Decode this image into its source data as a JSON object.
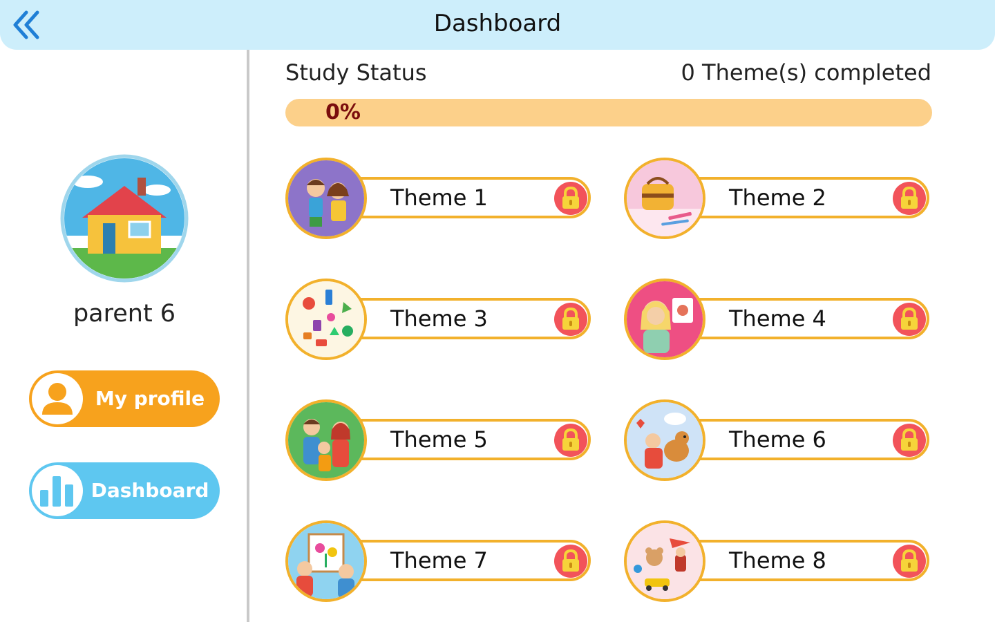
{
  "header": {
    "title": "Dashboard"
  },
  "sidebar": {
    "username": "parent 6",
    "profile_label": "My profile",
    "dashboard_label": "Dashboard"
  },
  "status": {
    "label": "Study Status",
    "completed_text": "0 Theme(s) completed",
    "progress_text": "0%",
    "progress_percent": 0
  },
  "themes": [
    {
      "label": "Theme 1",
      "locked": true
    },
    {
      "label": "Theme 2",
      "locked": true
    },
    {
      "label": "Theme 3",
      "locked": true
    },
    {
      "label": "Theme 4",
      "locked": true
    },
    {
      "label": "Theme 5",
      "locked": true
    },
    {
      "label": "Theme 6",
      "locked": true
    },
    {
      "label": "Theme 7",
      "locked": true
    },
    {
      "label": "Theme 8",
      "locked": true
    }
  ],
  "colors": {
    "header_bg": "#cdeefb",
    "accent_orange": "#f7a21d",
    "accent_blue": "#5ec7f0",
    "progress_track": "#fcd08a",
    "theme_border": "#f2b12c",
    "lock": "#f2535a"
  }
}
